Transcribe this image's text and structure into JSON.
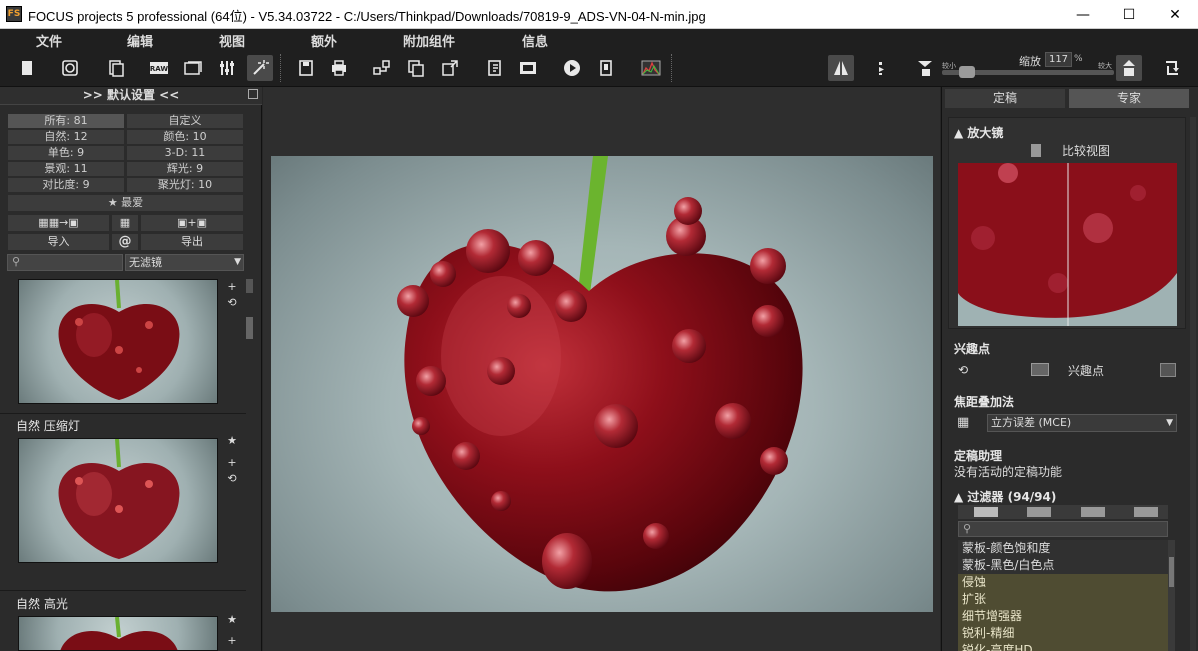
{
  "window": {
    "app_icon": "FS",
    "title": "FOCUS projects 5 professional (64位) - V5.34.03722 - C:/Users/Thinkpad/Downloads/70819-9_ADS-VN-04-N-min.jpg",
    "minimize": "—",
    "maximize": "☐",
    "close": "✕"
  },
  "menu": {
    "items": [
      "文件",
      "编辑",
      "视图",
      "额外",
      "附加组件",
      "信息"
    ]
  },
  "toolbar": {
    "zoom_label": "缩放",
    "zoom_value": "117",
    "zoom_unit": "%",
    "zoom_min_label": "较小",
    "zoom_max_label": "较大",
    "raw_label": "RAW"
  },
  "left_panel": {
    "header": ">> 默认设置 <<",
    "categories": [
      [
        "所有: 81",
        "自定义"
      ],
      [
        "自然: 12",
        "颜色: 10"
      ],
      [
        "单色: 9",
        "3-D: 11"
      ],
      [
        "景观: 11",
        "辉光: 9"
      ],
      [
        "对比度: 9",
        "聚光灯: 10"
      ]
    ],
    "favorites": "★ 最爱",
    "import_label": "导入",
    "at_symbol": "@",
    "export_label": "导出",
    "filter_value": "无滤镜",
    "presets": [
      "自然 压缩灯",
      "自然 高光"
    ]
  },
  "right_panel": {
    "tabs": [
      "定稿",
      "专家"
    ],
    "magnifier_title": "放大镜",
    "compare_view": "比较视图",
    "poi_title": "兴趣点",
    "poi_label": "兴趣点",
    "focus_stack_title": "焦距叠加法",
    "focus_stack_value": "立方误差 (MCE)",
    "finalize_title": "定稿助理",
    "finalize_status": "没有活动的定稿功能",
    "filters_title": "过滤器",
    "filters_count": "(94/94)",
    "filter_list": [
      "蒙板-颜色饱和度",
      "蒙板-黑色/白色点",
      "侵蚀",
      "扩张",
      "细节增强器",
      "锐利-精细",
      "锐化-高度HD"
    ]
  },
  "colors": {
    "background": "#262626",
    "panel": "#2b2b2b",
    "highlight_row": "#4f4c32"
  }
}
